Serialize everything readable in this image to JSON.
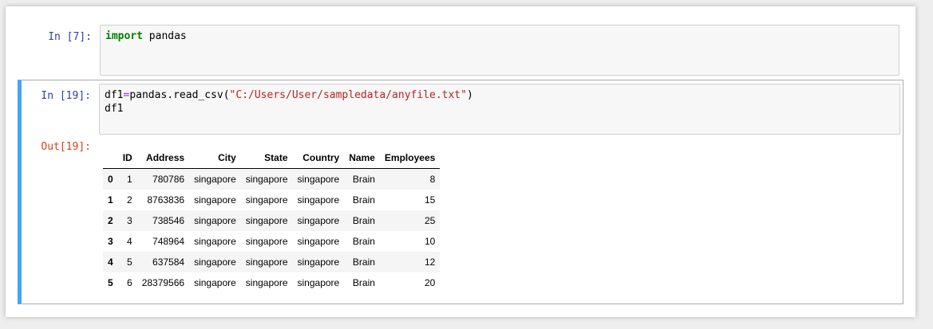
{
  "cells": [
    {
      "prompt": "In [7]:",
      "code": [
        [
          {
            "t": "import",
            "c": "kw"
          },
          {
            "t": " pandas",
            "c": ""
          }
        ]
      ]
    },
    {
      "prompt": "In [19]:",
      "code": [
        [
          {
            "t": "df1",
            "c": ""
          },
          {
            "t": "=",
            "c": "op"
          },
          {
            "t": "pandas.read_csv(",
            "c": ""
          },
          {
            "t": "\"C:/Users/User/sampledata/anyfile.txt\"",
            "c": "str"
          },
          {
            "t": ")",
            "c": ""
          }
        ],
        [
          {
            "t": "df1",
            "c": ""
          }
        ]
      ],
      "output_prompt": "Out[19]:"
    }
  ],
  "dataframe": {
    "columns": [
      "",
      "ID",
      "Address",
      "City",
      "State",
      "Country",
      "Name",
      "Employees"
    ],
    "rows": [
      [
        "0",
        "1",
        "780786",
        "singapore",
        "singapore",
        "singapore",
        "Brain",
        "8"
      ],
      [
        "1",
        "2",
        "8763836",
        "singapore",
        "singapore",
        "singapore",
        "Brain",
        "15"
      ],
      [
        "2",
        "3",
        "738546",
        "singapore",
        "singapore",
        "singapore",
        "Brain",
        "25"
      ],
      [
        "3",
        "4",
        "748964",
        "singapore",
        "singapore",
        "singapore",
        "Brain",
        "10"
      ],
      [
        "4",
        "5",
        "637584",
        "singapore",
        "singapore",
        "singapore",
        "Brain",
        "12"
      ],
      [
        "5",
        "6",
        "28379566",
        "singapore",
        "singapore",
        "singapore",
        "Brain",
        "20"
      ]
    ]
  },
  "colors": {
    "selected_cell_bar": "#42a5f5",
    "in_prompt": "#303f9f",
    "out_prompt": "#d84315",
    "keyword": "#008000",
    "string": "#ba2121"
  }
}
